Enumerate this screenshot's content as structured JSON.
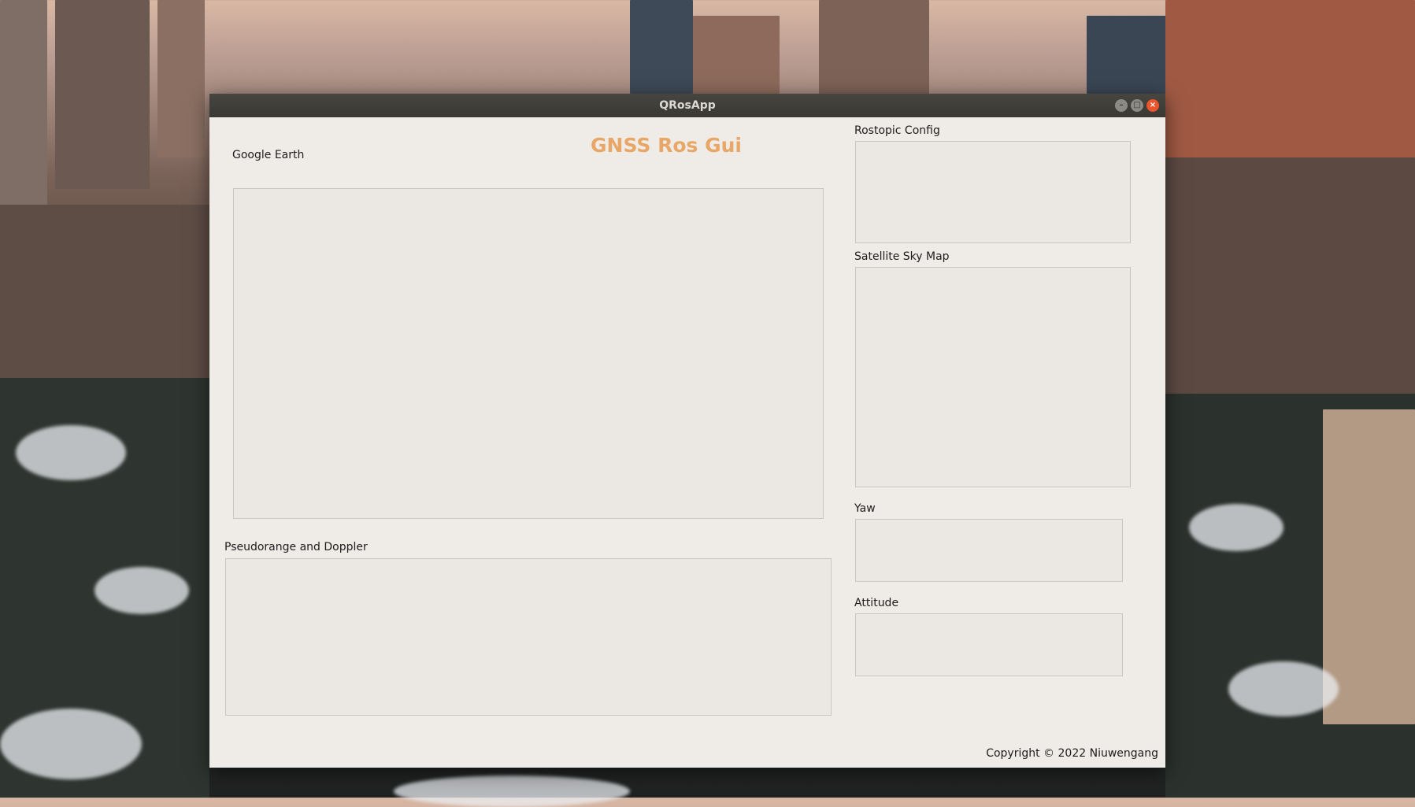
{
  "window": {
    "title": "QRosApp",
    "controls": {
      "minimize": "–",
      "maximize": "□",
      "close": "×"
    }
  },
  "app": {
    "heading": "GNSS Ros Gui",
    "copyright": "Copyright © 2022 Niuwengang"
  },
  "panels": {
    "google_earth": "Google Earth",
    "pseudorange": "Pseudorange and Doppler",
    "rostopic_config": "Rostopic Config",
    "sky_map": "Satellite Sky Map",
    "yaw": "Yaw",
    "attitude": "Attitude"
  },
  "colors": {
    "heading": "#e8a766",
    "window_bg": "#efebe7",
    "titlebar": "#3a3834",
    "close_button": "#e9552d"
  }
}
